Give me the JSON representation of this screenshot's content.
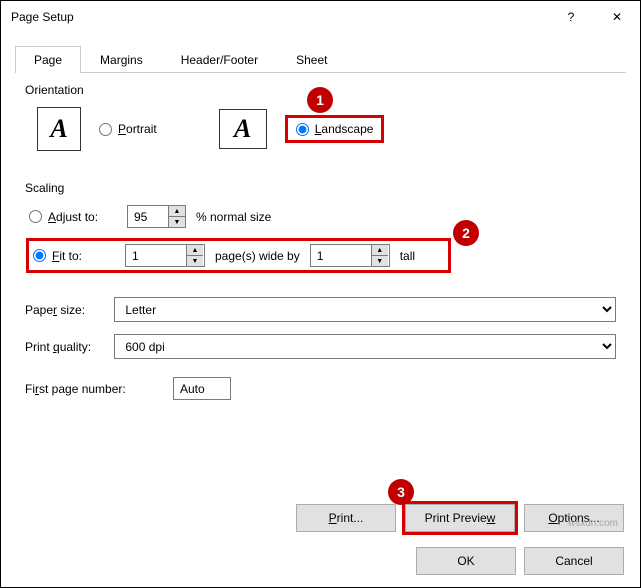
{
  "window": {
    "title": "Page Setup",
    "help": "?",
    "close": "✕"
  },
  "tabs": {
    "page": "Page",
    "margins": "Margins",
    "header_footer": "Header/Footer",
    "sheet": "Sheet"
  },
  "orientation": {
    "legend": "Orientation",
    "portrait_label": "Portrait",
    "landscape_label": "Landscape",
    "selected": "landscape"
  },
  "scaling": {
    "legend": "Scaling",
    "adjust_label": "Adjust to:",
    "adjust_value": "95",
    "adjust_suffix": "% normal size",
    "fit_label": "Fit to:",
    "fit_wide": "1",
    "fit_wide_suffix": "page(s) wide by",
    "fit_tall": "1",
    "fit_tall_suffix": "tall",
    "selected": "fit"
  },
  "paper_size": {
    "label": "Paper size:",
    "value": "Letter"
  },
  "print_quality": {
    "label": "Print quality:",
    "value": "600 dpi"
  },
  "first_page": {
    "label": "First page number:",
    "value": "Auto"
  },
  "buttons": {
    "print": "Print...",
    "print_preview": "Print Preview",
    "options": "Options...",
    "ok": "OK",
    "cancel": "Cancel"
  },
  "badges": {
    "one": "1",
    "two": "2",
    "three": "3"
  },
  "watermark": "wsxdn.com"
}
